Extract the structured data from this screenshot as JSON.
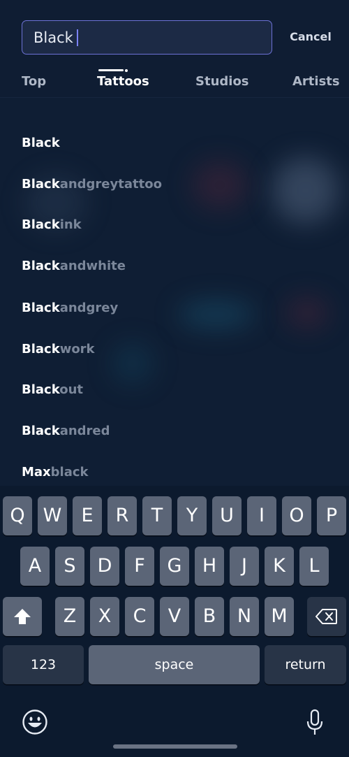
{
  "search": {
    "value": "Black",
    "cancel_label": "Cancel"
  },
  "tabs": [
    {
      "label": "Top",
      "selected": false
    },
    {
      "label": "Tattoos",
      "selected": true
    },
    {
      "label": "Studios",
      "selected": false
    },
    {
      "label": "Artists",
      "selected": false
    }
  ],
  "suggestions": [
    {
      "match": "Black",
      "rest": ""
    },
    {
      "match": "Black",
      "rest": "andgreytattoo"
    },
    {
      "match": "Black",
      "rest": "ink"
    },
    {
      "match": "Black",
      "rest": "andwhite"
    },
    {
      "match": "Black",
      "rest": "andgrey"
    },
    {
      "match": "Black",
      "rest": "work"
    },
    {
      "match": "Black",
      "rest": "out"
    },
    {
      "match": "Black",
      "rest": "andred"
    },
    {
      "match": "Max",
      "rest": "black"
    }
  ],
  "keyboard": {
    "row1": [
      "Q",
      "W",
      "E",
      "R",
      "T",
      "Y",
      "U",
      "I",
      "O",
      "P"
    ],
    "row2": [
      "A",
      "S",
      "D",
      "F",
      "G",
      "H",
      "J",
      "K",
      "L"
    ],
    "row3": [
      "Z",
      "X",
      "C",
      "V",
      "B",
      "N",
      "M"
    ],
    "numbers_label": "123",
    "space_label": "space",
    "return_label": "return",
    "shift_icon": "shift-arrow-icon",
    "delete_icon": "backspace-icon",
    "emoji_icon": "emoji-face-icon",
    "mic_icon": "microphone-icon"
  },
  "colors": {
    "accent": "#6d72d6",
    "background": "#0f1e34",
    "suggestion_muted": "#7b879a"
  }
}
